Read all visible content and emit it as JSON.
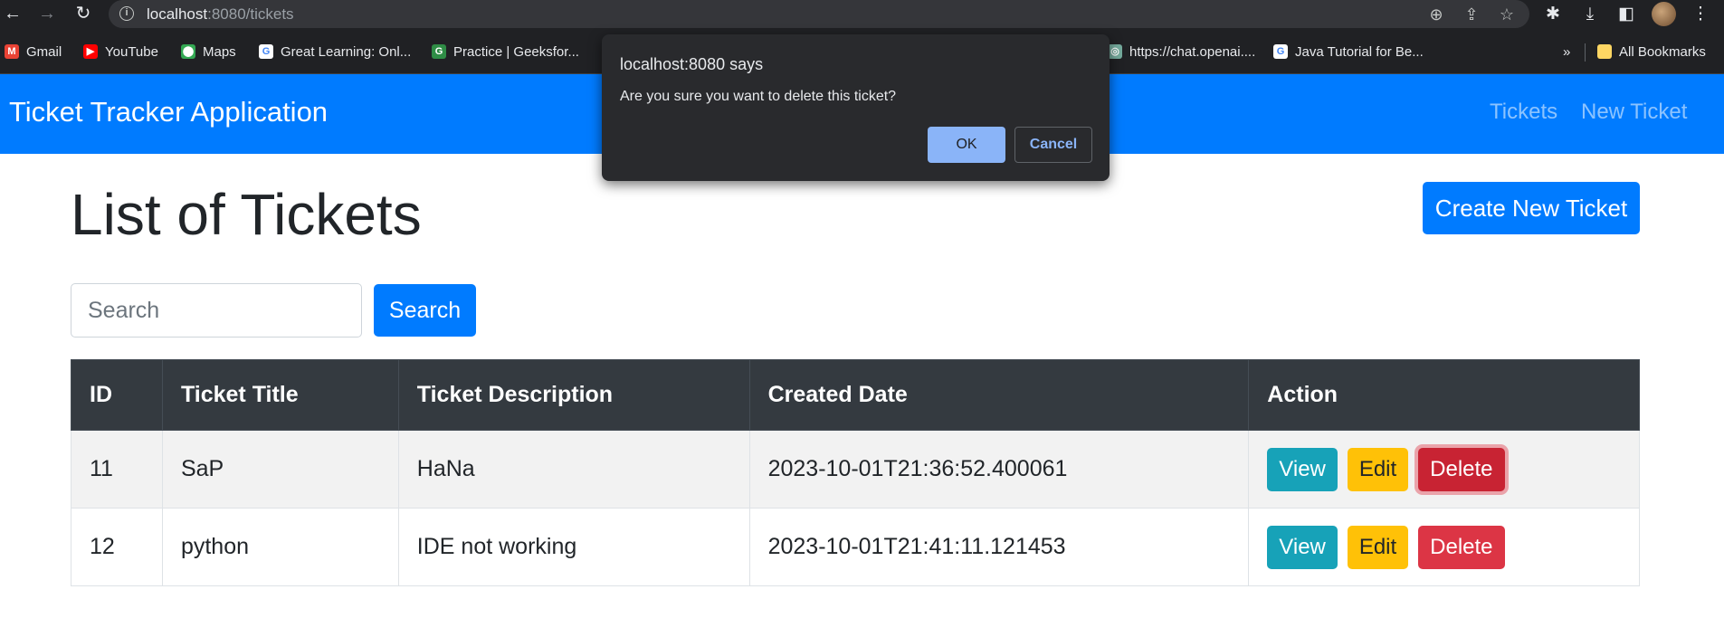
{
  "browser": {
    "url_host": "localhost",
    "url_rest": ":8080/tickets",
    "bookmarks": [
      {
        "label": "Gmail",
        "icon": "gmail-icon",
        "color": "#ea4335"
      },
      {
        "label": "YouTube",
        "icon": "youtube-icon",
        "color": "#ff0000"
      },
      {
        "label": "Maps",
        "icon": "maps-icon",
        "color": "#34a853"
      },
      {
        "label": "Great Learning: Onl...",
        "icon": "google-icon",
        "color": "#ffffff"
      },
      {
        "label": "Practice | Geeksfor...",
        "icon": "geeksforgeeks-icon",
        "color": "#2f8d46"
      },
      {
        "label": "https://chat.openai....",
        "icon": "openai-icon",
        "color": "#74aa9c"
      },
      {
        "label": "Java Tutorial for Be...",
        "icon": "google-icon",
        "color": "#ffffff"
      }
    ],
    "more_bookmarks": "»",
    "all_bookmarks": "All Bookmarks"
  },
  "app": {
    "brand": "Ticket Tracker Application",
    "nav": [
      "Tickets",
      "New Ticket"
    ],
    "page_title": "List of Tickets",
    "create_button": "Create New Ticket",
    "search_placeholder": "Search",
    "search_button": "Search",
    "table": {
      "headers": [
        "ID",
        "Ticket Title",
        "Ticket Description",
        "Created Date",
        "Action"
      ],
      "rows": [
        {
          "id": "11",
          "title": "SaP",
          "description": "HaNa",
          "created": "2023-10-01T21:36:52.400061"
        },
        {
          "id": "12",
          "title": "python",
          "description": "IDE not working",
          "created": "2023-10-01T21:41:11.121453"
        }
      ],
      "actions": {
        "view": "View",
        "edit": "Edit",
        "delete": "Delete"
      }
    }
  },
  "dialog": {
    "title": "localhost:8080 says",
    "message": "Are you sure you want to delete this ticket?",
    "ok": "OK",
    "cancel": "Cancel"
  },
  "colors": {
    "primary": "#007bff",
    "table_header": "#343a40",
    "view": "#17a2b8",
    "edit": "#ffc107",
    "delete": "#dc3545"
  }
}
